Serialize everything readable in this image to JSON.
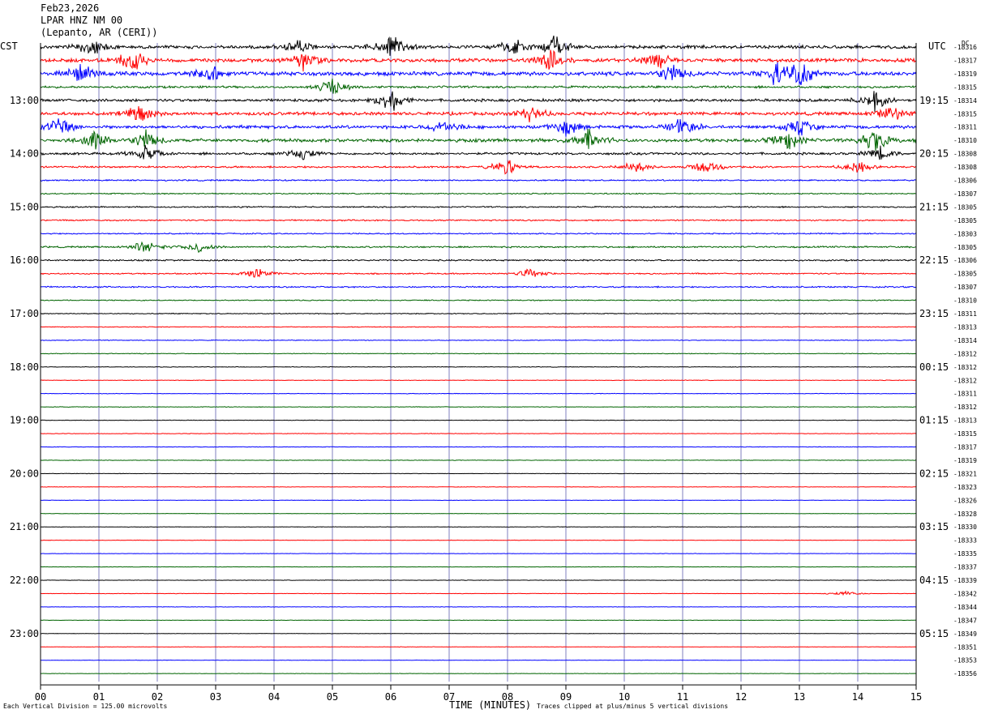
{
  "header": {
    "date": "Feb23,2026",
    "station": "LPAR HNZ NM 00",
    "location": "(Lepanto, AR (CERI))"
  },
  "left_timezone": "CST",
  "right_timezone": "UTC",
  "dc_label": "DC",
  "footer": {
    "scale_text": "Each Vertical Division = 125.00 microvolts",
    "xlabel": "TIME (MINUTES)",
    "clip_text": "Traces clipped at plus/minus 5 vertical divisions"
  },
  "colors": {
    "trace_cycle": [
      "#000000",
      "#ff0000",
      "#0000ff",
      "#006400"
    ],
    "grid": "#7f7fbf"
  },
  "chart_data": {
    "type": "line",
    "title": "LPAR HNZ NM 00",
    "xlabel": "TIME (MINUTES)",
    "ylabel": "",
    "xlim": [
      0,
      15
    ],
    "x_ticks": [
      "00",
      "01",
      "02",
      "03",
      "04",
      "05",
      "06",
      "07",
      "08",
      "09",
      "10",
      "11",
      "12",
      "13",
      "14",
      "15"
    ],
    "left_hour_labels": [
      "13:00",
      "14:00",
      "15:00",
      "16:00",
      "17:00",
      "18:00",
      "19:00",
      "20:00",
      "21:00",
      "22:00",
      "23:00"
    ],
    "right_hour_labels": [
      "19:15",
      "20:15",
      "21:15",
      "22:15",
      "23:15",
      "00:15",
      "01:15",
      "02:15",
      "03:15",
      "04:15",
      "05:15"
    ],
    "dc_offsets": [
      -18316,
      -18317,
      -18319,
      -18315,
      -18314,
      -18315,
      -18311,
      -18310,
      -18308,
      -18308,
      -18306,
      -18307,
      -18305,
      -18305,
      -18303,
      -18305,
      -18306,
      -18305,
      -18307,
      -18310,
      -18311,
      -18313,
      -18314,
      -18312,
      -18312,
      -18312,
      -18311,
      -18312,
      -18313,
      -18315,
      -18317,
      -18319,
      -18321,
      -18323,
      -18326,
      -18328,
      -18330,
      -18333,
      -18335,
      -18337,
      -18339,
      -18342,
      -18344,
      -18347,
      -18349,
      -18351,
      -18353,
      -18356
    ],
    "trace_activity": [
      1.6,
      1.8,
      2.0,
      1.1,
      1.4,
      1.6,
      1.6,
      1.7,
      1.2,
      0.9,
      0.7,
      0.6,
      0.65,
      0.7,
      0.6,
      0.8,
      0.75,
      0.65,
      0.7,
      0.5,
      0.45,
      0.35,
      0.35,
      0.35,
      0.3,
      0.3,
      0.28,
      0.28,
      0.25,
      0.25,
      0.25,
      0.25,
      0.22,
      0.22,
      0.22,
      0.22,
      0.22,
      0.22,
      0.2,
      0.2,
      0.2,
      0.2,
      0.2,
      0.2,
      0.2,
      0.2,
      0.2,
      0.2
    ],
    "event_bursts": [
      {
        "trace": 0,
        "minute": 0.9,
        "amp": 10
      },
      {
        "trace": 0,
        "minute": 4.4,
        "amp": 8
      },
      {
        "trace": 0,
        "minute": 6.0,
        "amp": 14
      },
      {
        "trace": 0,
        "minute": 8.1,
        "amp": 10
      },
      {
        "trace": 0,
        "minute": 8.8,
        "amp": 12
      },
      {
        "trace": 1,
        "minute": 1.6,
        "amp": 12
      },
      {
        "trace": 1,
        "minute": 4.5,
        "amp": 10
      },
      {
        "trace": 1,
        "minute": 8.7,
        "amp": 12
      },
      {
        "trace": 1,
        "minute": 10.6,
        "amp": 8
      },
      {
        "trace": 2,
        "minute": 0.7,
        "amp": 10
      },
      {
        "trace": 2,
        "minute": 2.9,
        "amp": 8
      },
      {
        "trace": 2,
        "minute": 10.8,
        "amp": 10
      },
      {
        "trace": 2,
        "minute": 12.6,
        "amp": 12
      },
      {
        "trace": 2,
        "minute": 13.0,
        "amp": 16
      },
      {
        "trace": 3,
        "minute": 5.0,
        "amp": 10
      },
      {
        "trace": 4,
        "minute": 6.0,
        "amp": 12
      },
      {
        "trace": 4,
        "minute": 14.3,
        "amp": 10
      },
      {
        "trace": 5,
        "minute": 1.7,
        "amp": 10
      },
      {
        "trace": 5,
        "minute": 8.4,
        "amp": 8
      },
      {
        "trace": 5,
        "minute": 14.6,
        "amp": 10
      },
      {
        "trace": 6,
        "minute": 0.3,
        "amp": 10
      },
      {
        "trace": 6,
        "minute": 6.9,
        "amp": 8
      },
      {
        "trace": 6,
        "minute": 9.0,
        "amp": 10
      },
      {
        "trace": 6,
        "minute": 11.0,
        "amp": 10
      },
      {
        "trace": 6,
        "minute": 13.0,
        "amp": 9
      },
      {
        "trace": 7,
        "minute": 0.9,
        "amp": 10
      },
      {
        "trace": 7,
        "minute": 1.8,
        "amp": 10
      },
      {
        "trace": 7,
        "minute": 9.4,
        "amp": 12
      },
      {
        "trace": 7,
        "minute": 12.8,
        "amp": 10
      },
      {
        "trace": 7,
        "minute": 14.3,
        "amp": 12
      },
      {
        "trace": 8,
        "minute": 1.8,
        "amp": 8
      },
      {
        "trace": 8,
        "minute": 4.5,
        "amp": 6
      },
      {
        "trace": 8,
        "minute": 14.4,
        "amp": 7
      },
      {
        "trace": 9,
        "minute": 8.0,
        "amp": 9
      },
      {
        "trace": 9,
        "minute": 10.2,
        "amp": 6
      },
      {
        "trace": 9,
        "minute": 11.4,
        "amp": 8
      },
      {
        "trace": 9,
        "minute": 14.0,
        "amp": 6
      },
      {
        "trace": 15,
        "minute": 1.8,
        "amp": 7
      },
      {
        "trace": 15,
        "minute": 2.7,
        "amp": 6
      },
      {
        "trace": 17,
        "minute": 3.7,
        "amp": 6
      },
      {
        "trace": 17,
        "minute": 8.4,
        "amp": 5
      },
      {
        "trace": 41,
        "minute": 13.8,
        "amp": 3
      }
    ]
  }
}
